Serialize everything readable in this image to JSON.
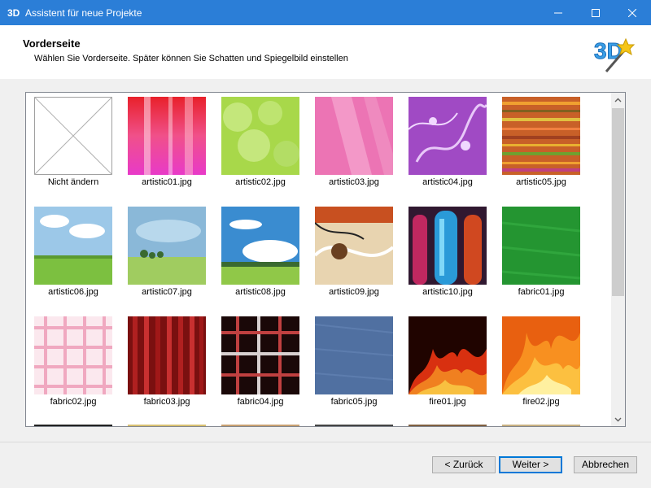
{
  "window": {
    "title": "Assistent für neue Projekte",
    "app_icon": "3d-icon",
    "controls": [
      "minimize-icon",
      "maximize-icon",
      "close-icon"
    ]
  },
  "header": {
    "title": "Vorderseite",
    "subtitle": "Wählen Sie Vorderseite. Später können Sie Schatten und Spiegelbild einstellen",
    "logo_text": "3D"
  },
  "gallery": {
    "items": [
      {
        "label": "Nicht ändern"
      },
      {
        "label": "artistic01.jpg"
      },
      {
        "label": "artistic02.jpg"
      },
      {
        "label": "artistic03.jpg"
      },
      {
        "label": "artistic04.jpg"
      },
      {
        "label": "artistic05.jpg"
      },
      {
        "label": "artistic06.jpg"
      },
      {
        "label": "artistic07.jpg"
      },
      {
        "label": "artistic08.jpg"
      },
      {
        "label": "artistic09.jpg"
      },
      {
        "label": "artistic10.jpg"
      },
      {
        "label": "fabric01.jpg"
      },
      {
        "label": "fabric02.jpg"
      },
      {
        "label": "fabric03.jpg"
      },
      {
        "label": "fabric04.jpg"
      },
      {
        "label": "fabric05.jpg"
      },
      {
        "label": "fire01.jpg"
      },
      {
        "label": "fire02.jpg"
      }
    ]
  },
  "buttons": {
    "back": "< Zurück",
    "next": "Weiter >",
    "cancel": "Abbrechen"
  }
}
